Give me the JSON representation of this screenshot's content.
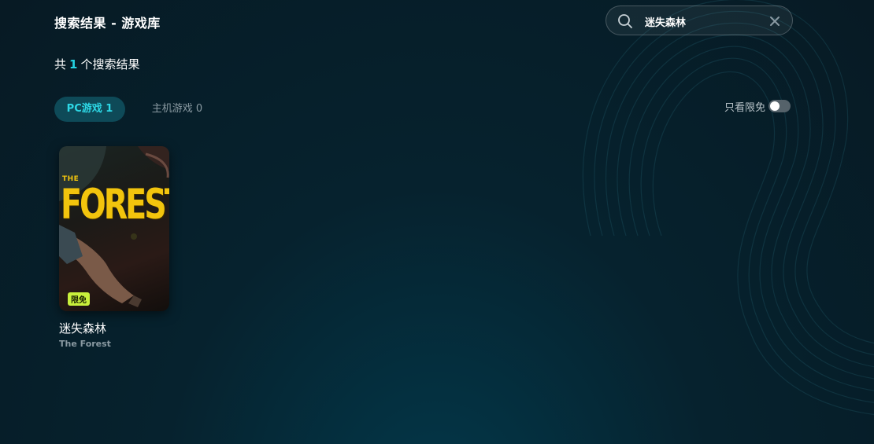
{
  "header": {
    "title": "搜索结果 - 游戏库"
  },
  "results": {
    "prefix": "共",
    "count": "1",
    "suffix": "个搜索结果"
  },
  "search": {
    "value": "迷失森林",
    "icon": "search-icon",
    "clear_icon": "close-icon"
  },
  "tabs": [
    {
      "label": "PC游戏 1",
      "active": true
    },
    {
      "label": "主机游戏 0",
      "active": false
    }
  ],
  "filter": {
    "label": "只看限免",
    "enabled": false
  },
  "games": [
    {
      "cover_small_text": "THE",
      "cover_title": "FOREST",
      "badge": "限免",
      "name": "迷失森林",
      "english_name": "The Forest"
    }
  ],
  "colors": {
    "accent": "#24d3e3",
    "badge": "#c8f03c",
    "logo": "#f2c40d"
  }
}
